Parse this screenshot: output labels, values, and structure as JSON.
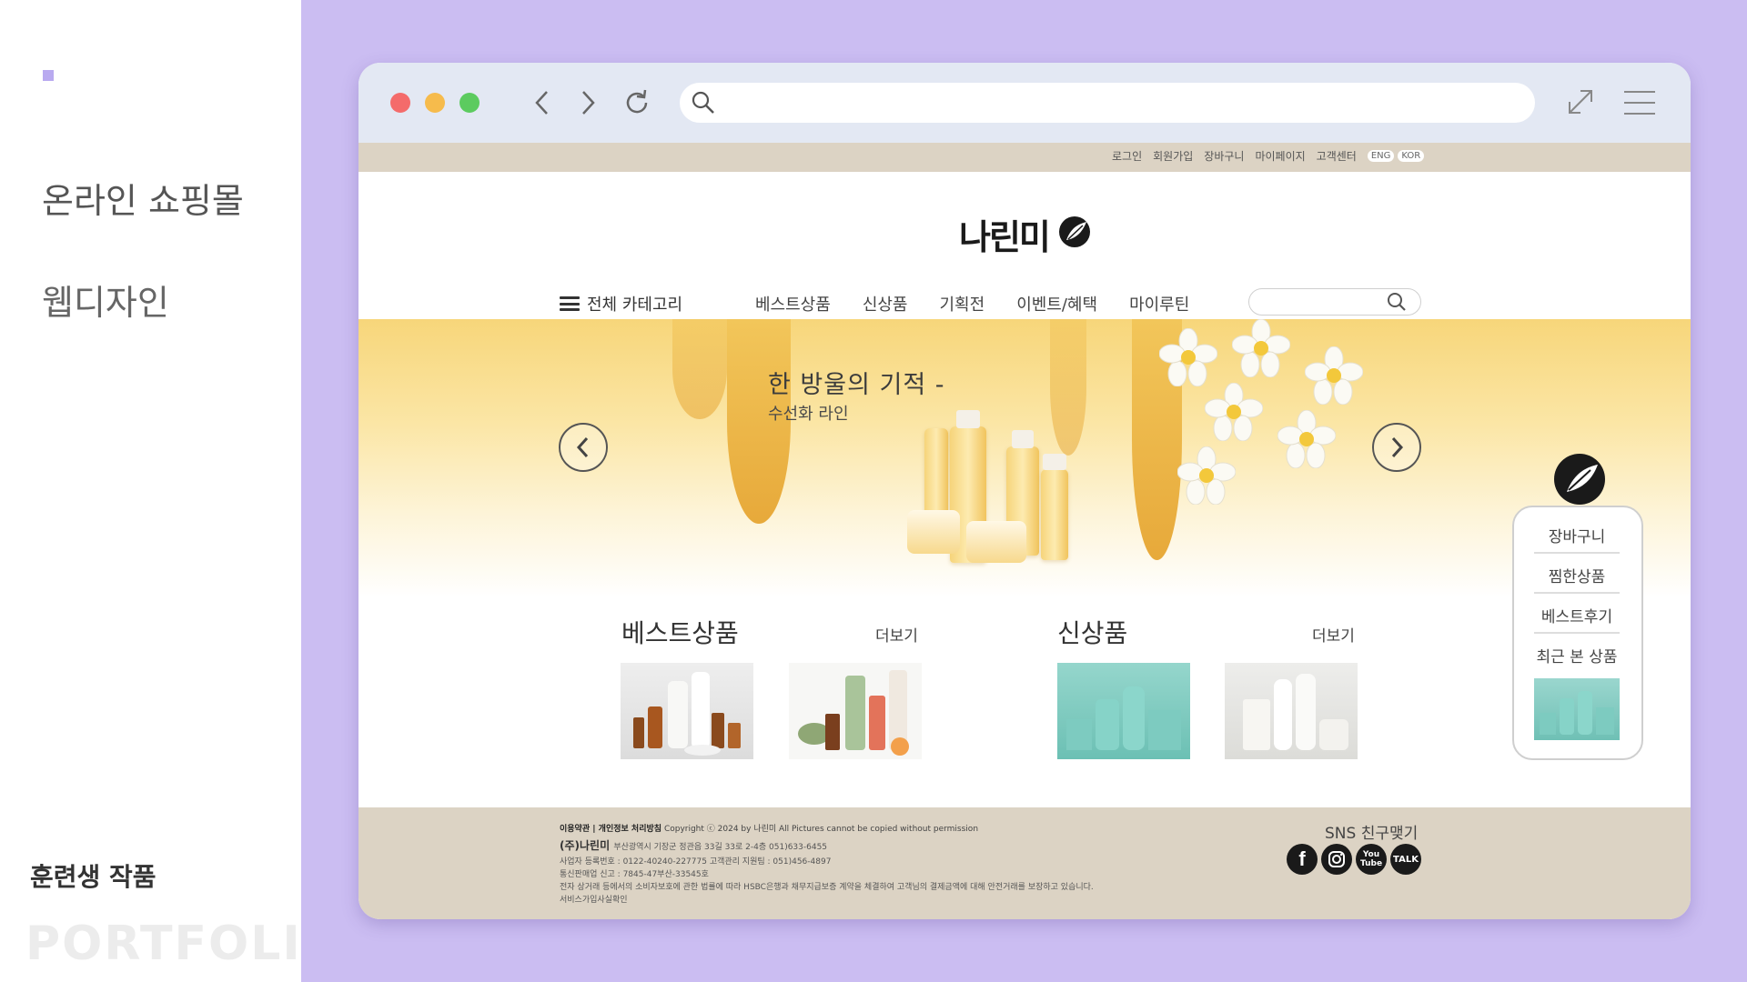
{
  "portfolio": {
    "title": "온라인 쇼핑몰",
    "subtitle": "웹디자인",
    "label": "훈련생 작품",
    "watermark": "PORTFOLIO"
  },
  "browser": {
    "url_value": "",
    "traffic_colors": [
      "#f46b6b",
      "#f6bb4c",
      "#5ccb5f"
    ]
  },
  "util_bar": {
    "links": [
      "로그인",
      "회원가입",
      "장바구니",
      "마이페이지",
      "고객센터"
    ],
    "languages": [
      "ENG",
      "KOR"
    ]
  },
  "site": {
    "logo_text": "나린미",
    "all_category": "전체 카테고리",
    "menu": [
      "베스트상품",
      "신상품",
      "기획전",
      "이벤트/혜택",
      "마이루틴"
    ],
    "search_placeholder": ""
  },
  "hero": {
    "headline": "한 방울의 기적 -",
    "subline": "수선화 라인"
  },
  "sections": {
    "best": {
      "title": "베스트상품",
      "more": "더보기"
    },
    "new": {
      "title": "신상품",
      "more": "더보기"
    }
  },
  "quick_menu": {
    "items": [
      "장바구니",
      "찜한상품",
      "베스트후기",
      "최근 본 상품"
    ]
  },
  "footer": {
    "legal_links": "이용약관 | 개인정보 처리방침",
    "copyright": "Copyright ⓒ 2024 by 나린미 All Pictures cannot be copied without permission",
    "company": "(주)나린미",
    "address": "부산광역시 기장군 정관읍 33길 33로 2-4층 051)633-6455",
    "line3": "사업자 등록번호 : 0122-40240-227775   고객관리 지원팀 : 051)456-4897",
    "line4": "통신판매업 신고 : 7845-47부산-33545호",
    "line5": "전자 상거래 등에서의 소비자보호에 관한 법률에 따라 HSBC은행과 채무지급보증 계약을 체결하여 고객님의 결제금액에 대해 안전거래를 보장하고 있습니다.",
    "line6": "서비스가입사실확인",
    "sns_title": "SNS 친구맺기",
    "sns_icons": [
      "facebook-icon",
      "instagram-icon",
      "youtube-icon",
      "kakaotalk-icon"
    ],
    "youtube_label": "You Tube",
    "talk_label": "TALK"
  }
}
